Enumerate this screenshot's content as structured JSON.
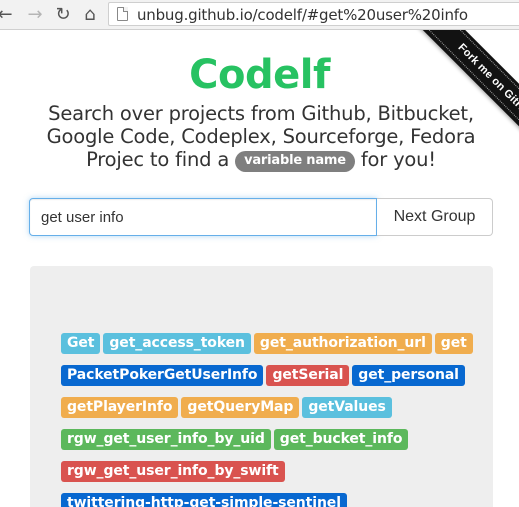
{
  "browser": {
    "url": "unbug.github.io/codelf/#get%20user%20info",
    "back_glyph": "←",
    "forward_glyph": "→",
    "reload_glyph": "↻",
    "home_glyph": "⌂"
  },
  "ribbon": {
    "label": "Fork me on GitHub"
  },
  "header": {
    "title": "Codelf",
    "subtitle_part1": "Search over projects from Github, Bitbucket, Google Code, Codeplex, Sourceforge, Fedora Projec to find a",
    "badge": "variable name",
    "subtitle_part2": "for you!"
  },
  "search": {
    "value": "get user info",
    "button_label": "Next Group"
  },
  "colors": {
    "title": "#27c262",
    "info": "#5bc0de",
    "warning": "#f0ad4e",
    "primary": "#0868d0",
    "danger": "#d9534f",
    "success": "#5cb85c"
  },
  "tag_rows": [
    [
      {
        "label": "Get",
        "color": "#5bc0de"
      },
      {
        "label": "get_access_token",
        "color": "#5bc0de"
      },
      {
        "label": "get_authorization_url",
        "color": "#f0ad4e"
      },
      {
        "label": "get",
        "color": "#f0ad4e"
      }
    ],
    [
      {
        "label": "PacketPokerGetUserInfo",
        "color": "#0868d0"
      },
      {
        "label": "getSerial",
        "color": "#d9534f"
      },
      {
        "label": "get_personal",
        "color": "#0868d0"
      }
    ],
    [
      {
        "label": "getPlayerInfo",
        "color": "#f0ad4e"
      },
      {
        "label": "getQueryMap",
        "color": "#f0ad4e"
      },
      {
        "label": "getValues",
        "color": "#5bc0de"
      }
    ],
    [
      {
        "label": "rgw_get_user_info_by_uid",
        "color": "#5cb85c"
      },
      {
        "label": "get_bucket_info",
        "color": "#5cb85c"
      }
    ],
    [
      {
        "label": "rgw_get_user_info_by_swift",
        "color": "#d9534f"
      }
    ],
    [
      {
        "label": "twittering-http-get-simple-sentinel",
        "color": "#0868d0"
      }
    ]
  ]
}
